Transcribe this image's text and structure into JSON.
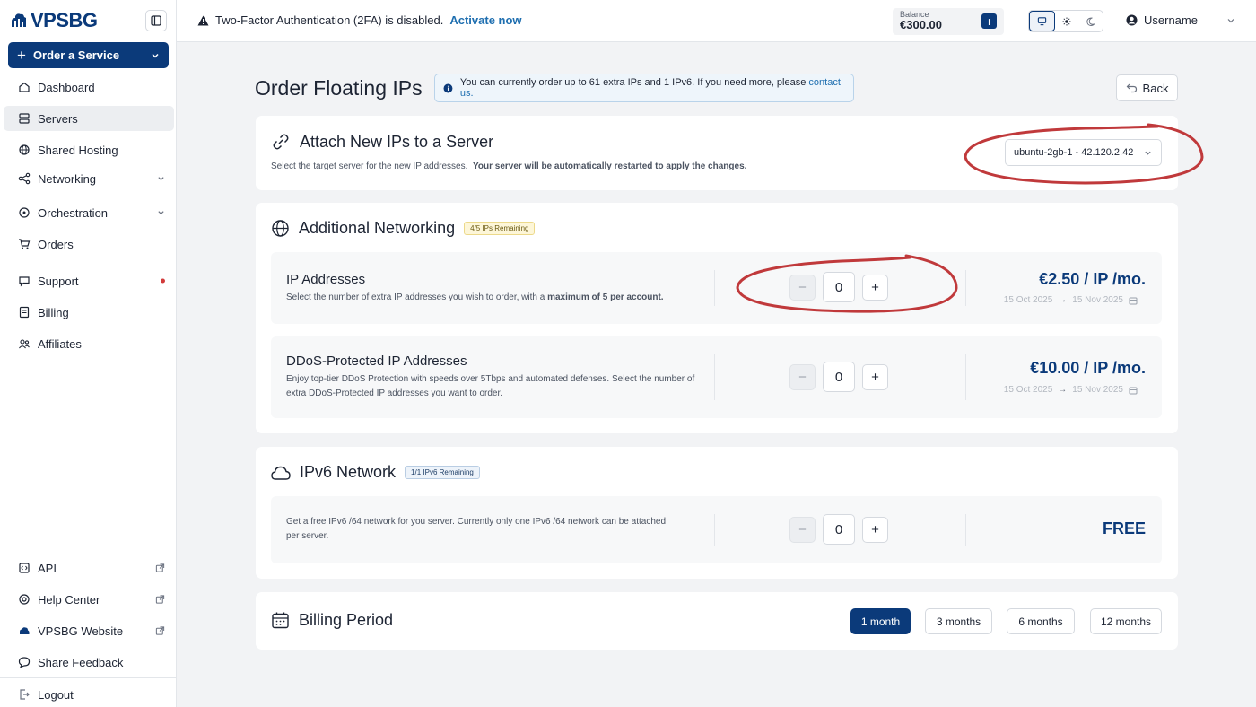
{
  "brand": {
    "logo_text": "VPSBG"
  },
  "sidebar": {
    "order_button": "Order a Service",
    "items": [
      {
        "label": "Dashboard",
        "icon": "home-icon"
      },
      {
        "label": "Servers",
        "icon": "server-icon"
      },
      {
        "label": "Shared Hosting",
        "icon": "globe-icon"
      },
      {
        "label": "Networking",
        "icon": "share-icon"
      },
      {
        "label": "Orchestration",
        "icon": "gauge-icon"
      },
      {
        "label": "Orders",
        "icon": "cart-icon"
      },
      {
        "label": "Support",
        "icon": "chat-icon"
      },
      {
        "label": "Billing",
        "icon": "billing-icon"
      },
      {
        "label": "Affiliates",
        "icon": "users-icon"
      }
    ],
    "bottom_items": [
      {
        "label": "API"
      },
      {
        "label": "Help Center"
      },
      {
        "label": "VPSBG Website"
      },
      {
        "label": "Share Feedback"
      },
      {
        "label": "Logout"
      }
    ]
  },
  "topbar": {
    "alert_text": "Two-Factor Authentication (2FA) is disabled.",
    "alert_link": "Activate now",
    "balance_label": "Balance",
    "balance_value": "€300.00",
    "username": "Username"
  },
  "page": {
    "title": "Order Floating IPs",
    "info_text": "You can currently order up to 61 extra IPs and 1 IPv6. If you need more, please",
    "info_link": "contact us.",
    "back_label": "Back"
  },
  "attach": {
    "title": "Attach New IPs to a Server",
    "subtitle": "Select the target server for the new IP addresses.",
    "subtitle_bold": "Your server will be automatically restarted to apply the changes.",
    "server_selected": "ubuntu-2gb-1 - 42.120.2.42"
  },
  "networking": {
    "title": "Additional Networking",
    "badge": "4/5 IPs Remaining",
    "ip": {
      "title": "IP Addresses",
      "desc": "Select the number of extra IP addresses you wish to order, with a",
      "desc_bold": "maximum of 5 per account.",
      "quantity": "0",
      "price": "€2.50 / IP /mo.",
      "date_from": "15 Oct 2025",
      "date_to": "15 Nov 2025"
    },
    "ddos": {
      "title": "DDoS-Protected IP Addresses",
      "desc": "Enjoy top-tier DDoS Protection with speeds over 5Tbps and automated defenses. Select the number of extra DDoS-Protected IP addresses you want to order.",
      "quantity": "0",
      "price": "€10.00 / IP /mo.",
      "date_from": "15 Oct 2025",
      "date_to": "15 Nov 2025"
    }
  },
  "ipv6": {
    "title": "IPv6 Network",
    "badge": "1/1 IPv6 Remaining",
    "desc": "Get a free IPv6 /64 network for you server. Currently only one IPv6 /64 network can be attached per server.",
    "quantity": "0",
    "price": "FREE"
  },
  "billing": {
    "title": "Billing Period",
    "options": [
      "1 month",
      "3 months",
      "6 months",
      "12 months"
    ],
    "selected": "1 month"
  },
  "colors": {
    "brand": "#0b3a7a",
    "link": "#1f6fb0",
    "annotation": "#c0393b"
  }
}
